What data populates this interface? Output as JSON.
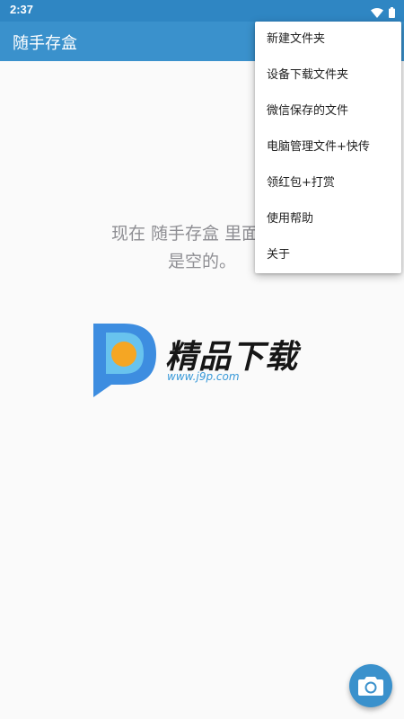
{
  "status_bar": {
    "time": "2:37",
    "icons": [
      "wifi-icon",
      "battery-icon"
    ]
  },
  "app_bar": {
    "title": "随手存盒"
  },
  "empty_state": {
    "line1": "现在 随手存盒 里面什么",
    "line2": "是空的。"
  },
  "menu": {
    "items": [
      {
        "label": "新建文件夹"
      },
      {
        "label": "设备下载文件夹"
      },
      {
        "label": "微信保存的文件"
      },
      {
        "label": "电脑管理文件+快传"
      },
      {
        "label": "领红包+打赏"
      },
      {
        "label": "使用帮助"
      },
      {
        "label": "关于"
      }
    ]
  },
  "watermark": {
    "brand": "精品下载",
    "url": "www.j9p.com"
  },
  "fab": {
    "icon": "camera-icon"
  },
  "colors": {
    "primary": "#3a91cc",
    "status_bar": "#2f86c3",
    "background": "#fafafa"
  }
}
